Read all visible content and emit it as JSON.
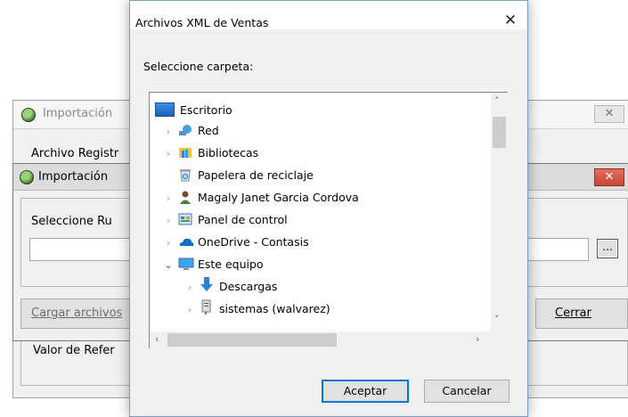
{
  "bg_window": {
    "title": "Importación",
    "close_glyph": "✕",
    "group_label": "Archivo Registr",
    "value_label": "Valor de Refer"
  },
  "mid_window": {
    "title": "Importación",
    "close_glyph": "✕",
    "route_label": "Seleccione Ru",
    "route_value": "",
    "browse_glyph": "...",
    "load_button": "Cargar archivos",
    "close_button": "Cerrar"
  },
  "dialog": {
    "title": "Archivos XML de Ventas",
    "close_glyph": "✕",
    "prompt": "Seleccione carpeta:",
    "tree": {
      "root": "Escritorio",
      "items": [
        {
          "label": "Red",
          "icon": "network-icon",
          "expandable": true
        },
        {
          "label": "Bibliotecas",
          "icon": "libraries-icon",
          "expandable": true
        },
        {
          "label": "Papelera de reciclaje",
          "icon": "recycle-bin-icon",
          "expandable": false
        },
        {
          "label": "Magaly Janet Garcia Cordova",
          "icon": "user-folder-icon",
          "expandable": true
        },
        {
          "label": "Panel de control",
          "icon": "control-panel-icon",
          "expandable": true
        },
        {
          "label": "OneDrive - Contasis",
          "icon": "onedrive-icon",
          "expandable": true
        },
        {
          "label": "Este equipo",
          "icon": "this-pc-icon",
          "expandable": true,
          "expanded": true
        }
      ],
      "children": [
        {
          "label": "Descargas",
          "icon": "downloads-icon"
        },
        {
          "label": "sistemas (walvarez)",
          "icon": "network-drive-icon"
        }
      ]
    },
    "ok_button": "Aceptar",
    "cancel_button": "Cancelar"
  },
  "colors": {
    "selection_blue": "#0078d7",
    "dialog_border": "#7a9ccc",
    "red_close": "#c74635"
  }
}
